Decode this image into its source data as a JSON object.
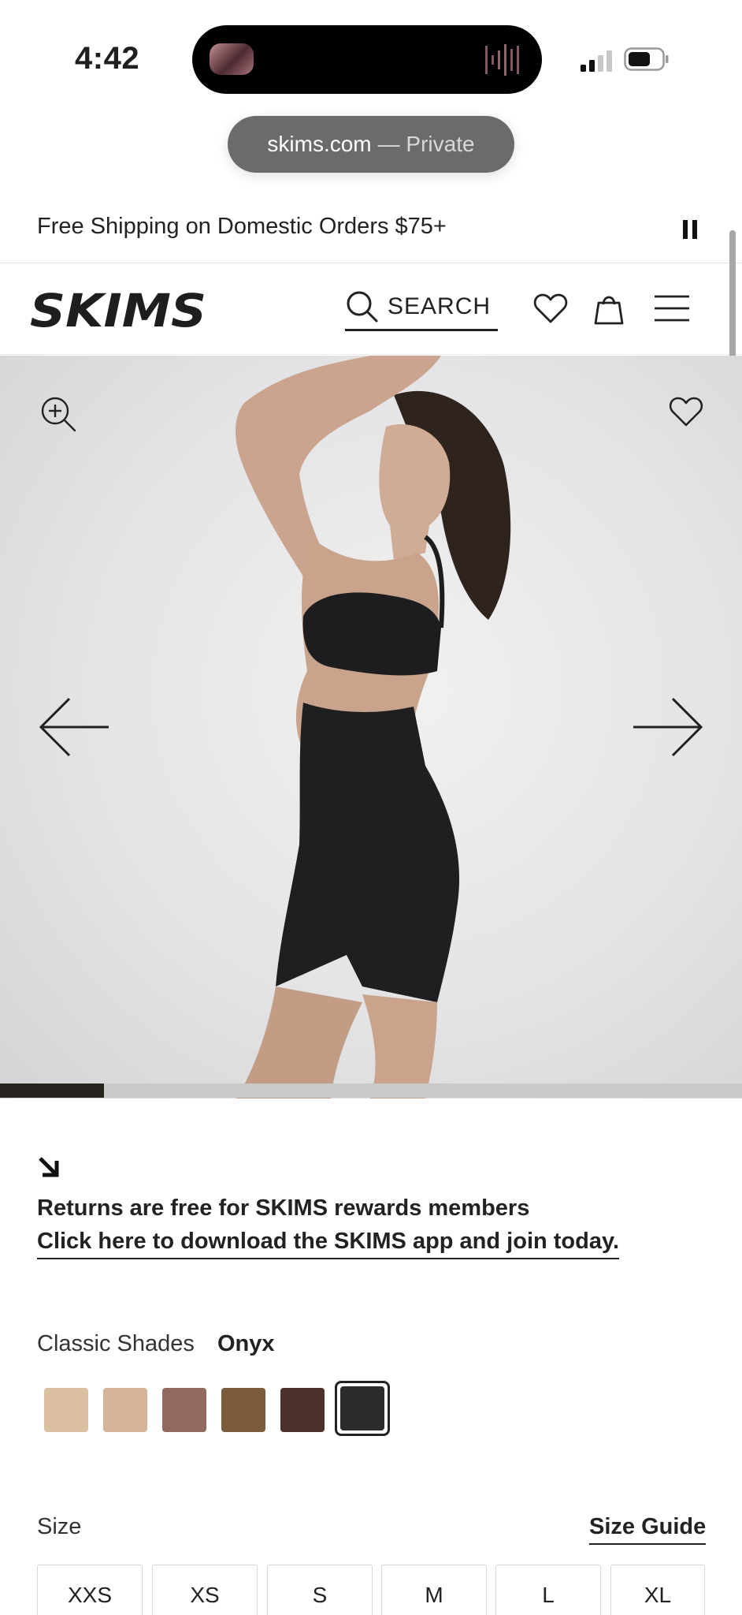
{
  "status_bar": {
    "time": "4:42",
    "signal_icon": "cellular-signal-icon",
    "battery_icon": "battery-icon"
  },
  "browser": {
    "domain": "skims.com",
    "mode": "— Private"
  },
  "announcement": {
    "text": "Free Shipping on Domestic Orders $75+",
    "pause_icon": "pause-icon"
  },
  "header": {
    "logo_text": "SKIMS",
    "search_label": "SEARCH",
    "icons": [
      "search-icon",
      "heart-icon",
      "bag-icon",
      "menu-icon"
    ]
  },
  "gallery": {
    "zoom_icon": "zoom-in-icon",
    "wishlist_icon": "heart-icon",
    "prev_icon": "arrow-left-icon",
    "next_icon": "arrow-right-icon",
    "progress_fraction": 0.14
  },
  "returns": {
    "line1": "Returns are free for SKIMS rewards members",
    "link": "Click here to download the SKIMS app and join today."
  },
  "shades": {
    "label": "Classic Shades",
    "selected": "Onyx",
    "colors": [
      "#dbbfa3",
      "#d4b59c",
      "#946a5e",
      "#7a5b3c",
      "#4b3129",
      "#2b2b2d"
    ]
  },
  "size": {
    "label": "Size",
    "guide_link": "Size Guide",
    "options": [
      "XXS",
      "XS",
      "S",
      "M",
      "L",
      "XL"
    ]
  },
  "colors": {
    "accent": "#222222",
    "progress": "#272420"
  }
}
